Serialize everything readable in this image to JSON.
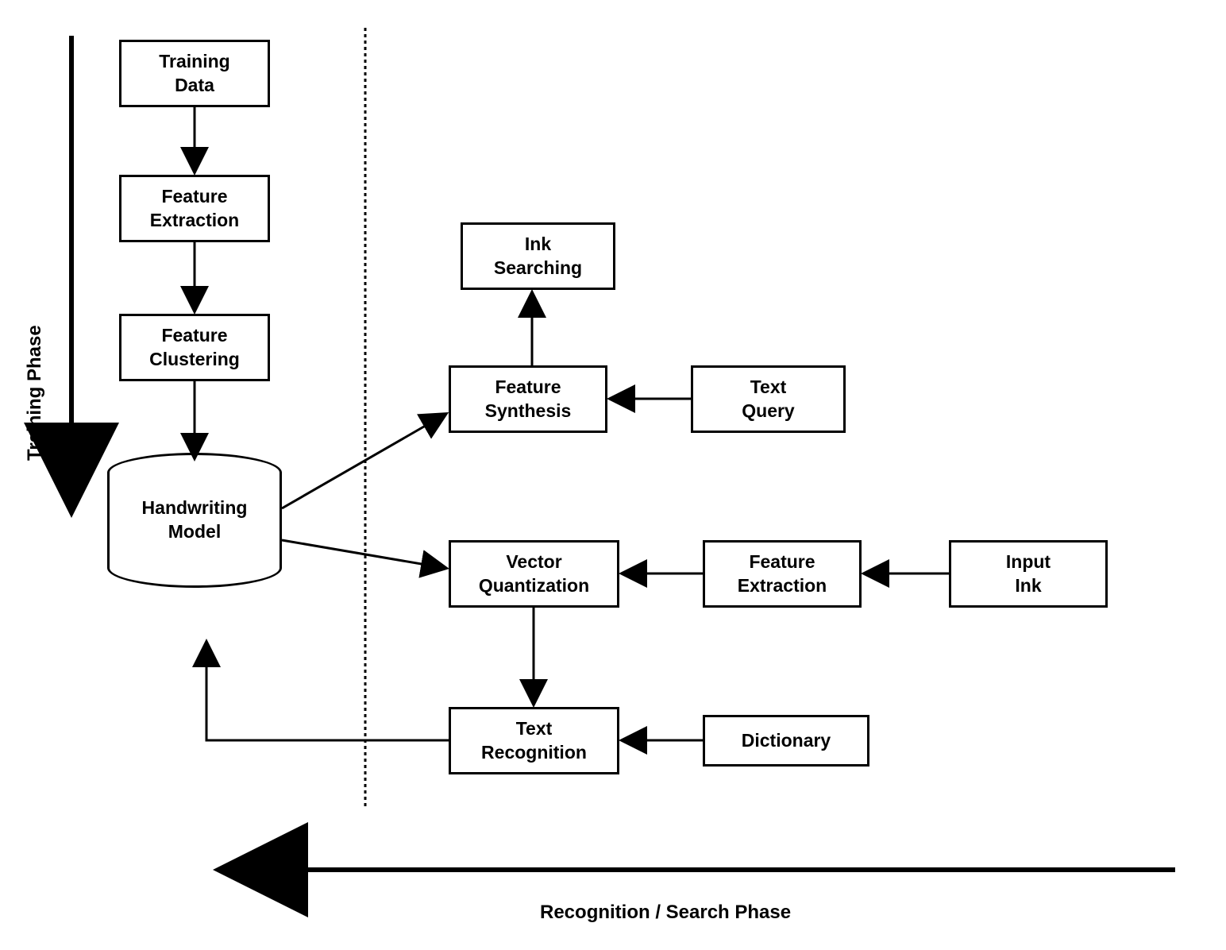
{
  "phases": {
    "training": "Training Phase",
    "recognition": "Recognition / Search Phase"
  },
  "boxes": {
    "training_data": "Training\nData",
    "feature_extraction_1": "Feature\nExtraction",
    "feature_clustering": "Feature\nClustering",
    "handwriting_model": "Handwriting\nModel",
    "ink_searching": "Ink\nSearching",
    "feature_synthesis": "Feature\nSynthesis",
    "text_query": "Text\nQuery",
    "vector_quantization": "Vector\nQuantization",
    "feature_extraction_2": "Feature\nExtraction",
    "input_ink": "Input\nInk",
    "text_recognition": "Text\nRecognition",
    "dictionary": "Dictionary"
  }
}
